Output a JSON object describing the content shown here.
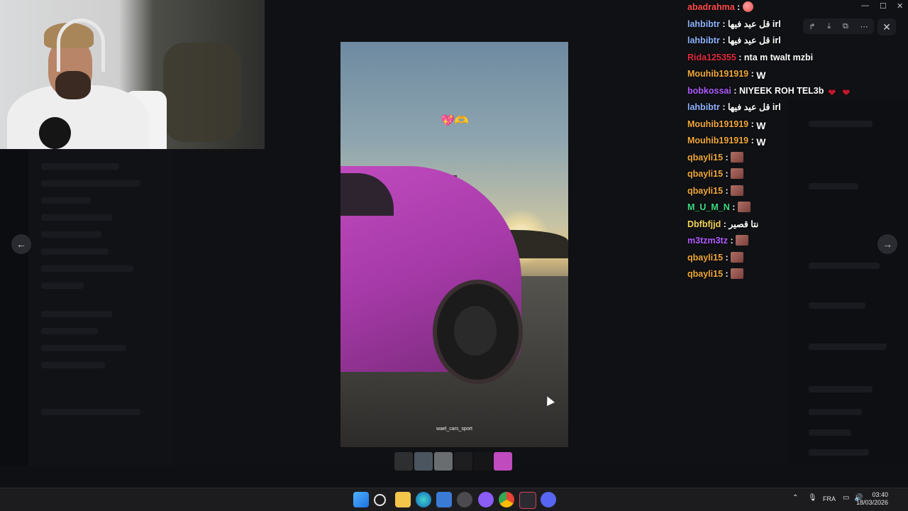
{
  "chat": {
    "messages": [
      {
        "user": "abadrahma",
        "color": "#ff4d4d",
        "text": "",
        "emote": "face"
      },
      {
        "user": "lahbibtr",
        "color": "#8fb4ff",
        "text": "قل عيد فيها irl",
        "emote": ""
      },
      {
        "user": "lahbibtr",
        "color": "#8fb4ff",
        "text": "قل عيد فيها irl",
        "emote": ""
      },
      {
        "user": "Rida125355",
        "color": "#e02b3d",
        "text": "nta m twalt mzbi",
        "emote": ""
      },
      {
        "user": "Mouhib191919",
        "color": "#f0a83c",
        "text": "",
        "emote": "W"
      },
      {
        "user": "bobkossai",
        "color": "#b05cff",
        "text": "NIYEEK ROH TEL3b",
        "emote": "hearts"
      },
      {
        "user": "lahbibtr",
        "color": "#8fb4ff",
        "text": "قل عيد فيها irl",
        "emote": ""
      },
      {
        "user": "Mouhib191919",
        "color": "#f0a83c",
        "text": "",
        "emote": "W"
      },
      {
        "user": "Mouhib191919",
        "color": "#f0a83c",
        "text": "",
        "emote": "W"
      },
      {
        "user": "qbayli15",
        "color": "#f0a83c",
        "text": "",
        "emote": "dodge"
      },
      {
        "user": "qbayli15",
        "color": "#f0a83c",
        "text": "",
        "emote": "dodge"
      },
      {
        "user": "qbayli15",
        "color": "#f0a83c",
        "text": "",
        "emote": "dodge"
      },
      {
        "user": "M_U_M_N",
        "color": "#3ddc84",
        "text": "",
        "emote": "dodge"
      },
      {
        "user": "Dbfbfjjd",
        "color": "#f3d55b",
        "text": "نتا قصير",
        "emote": ""
      },
      {
        "user": "m3tzm3tz",
        "color": "#b05cff",
        "text": "",
        "emote": "dodge"
      },
      {
        "user": "qbayli15",
        "color": "#f0a83c",
        "text": "",
        "emote": "dodge"
      },
      {
        "user": "qbayli15",
        "color": "#f0a83c",
        "text": "",
        "emote": "dodge"
      }
    ]
  },
  "viewer": {
    "image_watermark": "wael_cars_sport",
    "prev_icon": "←",
    "next_icon": "→",
    "close_icon": "✕",
    "toolbar_icons": [
      "↱",
      "⤓",
      "⧉",
      "⋯"
    ],
    "thumbnail_colors": [
      "#2d2f31",
      "#4b5560",
      "#6a6d70",
      "#1e1e21",
      "#161618",
      "#c04bbf"
    ]
  },
  "taskbar": {
    "language": "FRA",
    "time": "03:40",
    "date": "18/03/2026",
    "apps": [
      "start",
      "search",
      "file-explorer",
      "edge",
      "store",
      "app",
      "app2",
      "chrome",
      "media-player",
      "discord"
    ]
  }
}
